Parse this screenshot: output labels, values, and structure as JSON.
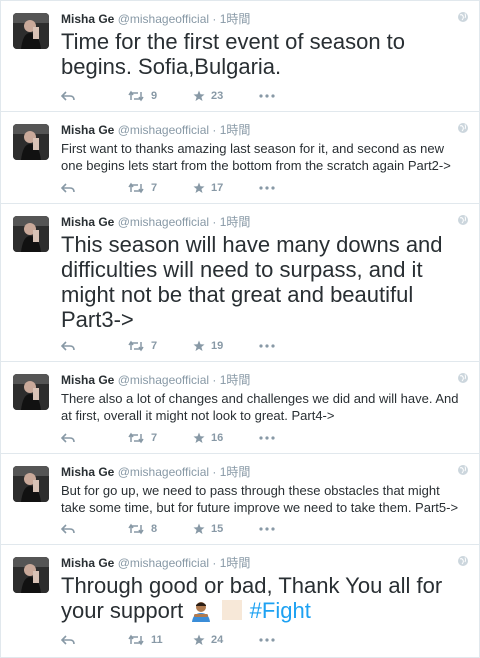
{
  "tweets": [
    {
      "name": "Misha Ge",
      "handle": "@mishageofficial",
      "time": "1時間",
      "text": "Time for the first event of season to begins. Sofia,Bulgaria.",
      "retweets": "9",
      "favorites": "23"
    },
    {
      "name": "Misha Ge",
      "handle": "@mishageofficial",
      "time": "1時間",
      "text": "First want to thanks amazing last season for it, and second as new one begins lets start from the bottom from the scratch again Part2->",
      "retweets": "7",
      "favorites": "17"
    },
    {
      "name": "Misha Ge",
      "handle": "@mishageofficial",
      "time": "1時間",
      "text": "This season will have many downs and difficulties will need to surpass, and it might not be that great and beautiful Part3->",
      "retweets": "7",
      "favorites": "19"
    },
    {
      "name": "Misha Ge",
      "handle": "@mishageofficial",
      "time": "1時間",
      "text": "There also a lot of changes and challenges we did and will have. And at first, overall it might not look to great. Part4->",
      "retweets": "7",
      "favorites": "16"
    },
    {
      "name": "Misha Ge",
      "handle": "@mishageofficial",
      "time": "1時間",
      "text": "But for go up, we need to pass through these obstacles that might take some time, but for future improve we need to take them. Part5->",
      "retweets": "8",
      "favorites": "15"
    },
    {
      "name": "Misha Ge",
      "handle": "@mishageofficial",
      "time": "1時間",
      "text": "Through good or bad, Thank You all for your support",
      "hashtag": "#Fight",
      "retweets": "11",
      "favorites": "24"
    }
  ],
  "icons": {
    "reply": "reply-icon",
    "retweet": "retweet-icon",
    "favorite": "star-icon",
    "more": "more-icon",
    "globe": "globe-icon",
    "emoji": "person-bowing-emoji"
  },
  "colors": {
    "muted": "#8899a6",
    "text": "#292f33",
    "hashtag": "#1da1f2",
    "divider": "#e1e8ed"
  }
}
